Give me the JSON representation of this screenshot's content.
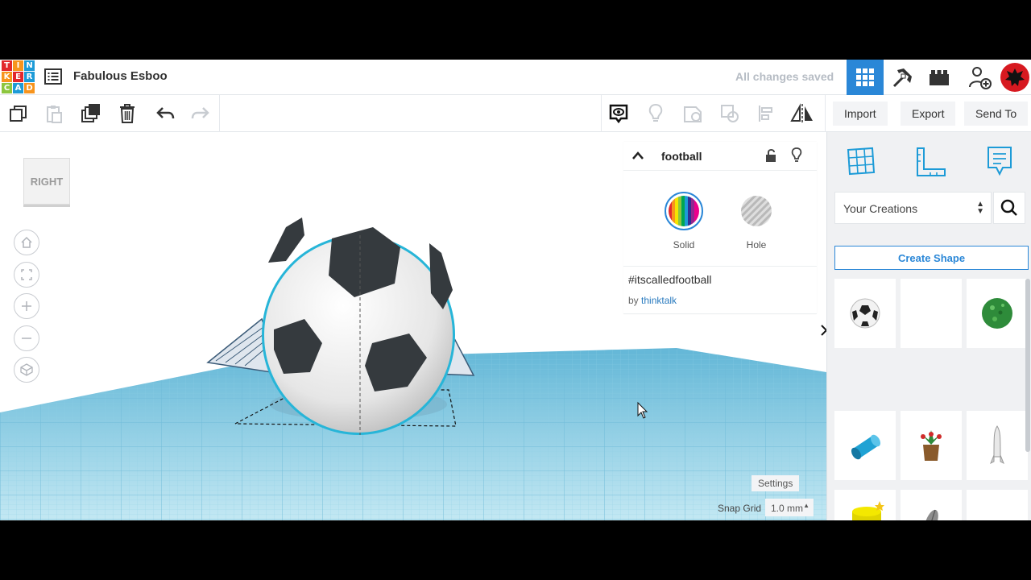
{
  "header": {
    "logo_letters": [
      "T",
      "I",
      "N",
      "K",
      "E",
      "R",
      "C",
      "A",
      "D"
    ],
    "logo_colors": [
      "#e2272d",
      "#f7941d",
      "#1d9bd7",
      "#f7941d",
      "#e2272d",
      "#1d9bd7",
      "#8dc63f",
      "#1d9bd7",
      "#f7941d"
    ],
    "design_title": "Fabulous Esboo",
    "save_status": "All changes saved",
    "icons": [
      "3d-design-grid-icon",
      "minecraft-pickaxe-icon",
      "lego-brick-icon",
      "add-user-icon",
      "user-avatar"
    ]
  },
  "toolbar": {
    "left_tools": [
      "copy-icon",
      "paste-icon",
      "duplicate-icon",
      "delete-icon",
      "undo-icon",
      "redo-icon"
    ],
    "right_tools": [
      "show-notes-icon",
      "light-bulb-icon",
      "group-icon",
      "ungroup-icon",
      "align-icon",
      "mirror-icon"
    ],
    "import_label": "Import",
    "export_label": "Export",
    "send_to_label": "Send To"
  },
  "workplane": {
    "viewcube_label": "RIGHT",
    "nav_tools": [
      "home-view-icon",
      "fit-view-icon",
      "zoom-in-icon",
      "zoom-out-icon",
      "perspective-icon"
    ],
    "settings_label": "Settings",
    "snap_grid_label": "Snap Grid",
    "snap_grid_value": "1.0 mm"
  },
  "inspector": {
    "shape_name": "football",
    "solid_label": "Solid",
    "hole_label": "Hole",
    "tag": "#itscalledfootball",
    "by_prefix": "by",
    "author": "thinktalk"
  },
  "sidebar": {
    "library_selected": "Your Creations",
    "create_shape_label": "Create Shape",
    "accent_color": "#2a87d7",
    "shapes": [
      "soccer-ball",
      "empty",
      "green-sphere",
      "blue-cylinder",
      "potted-plant",
      "rocket",
      "yellow-cylinder",
      "feather"
    ]
  }
}
